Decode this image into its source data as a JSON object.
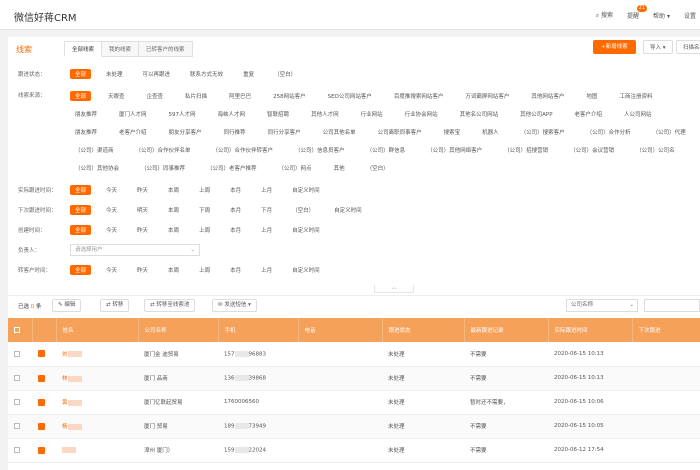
{
  "app": {
    "title": "微信好蒋CRM"
  },
  "topnav": {
    "search": "搜索",
    "reminder": "提醒",
    "reminder_badge": "21",
    "help": "帮助",
    "settings": "设置"
  },
  "leads": {
    "title": "线索",
    "tabs": [
      "全部线索",
      "我的线索",
      "已转客户的线索"
    ],
    "new_button": "+新增线索",
    "import_button": "导入 ▾",
    "scan_button": "扫描名"
  },
  "filters": {
    "follow_status": {
      "label": "跟进状态：",
      "options": [
        "全部",
        "未处理",
        "可以再跟进",
        "联系方式无效",
        "重复",
        "（空白）"
      ]
    },
    "source": {
      "label": "线索来源：",
      "rows": [
        [
          "全部",
          "天眼查",
          "企查查",
          "私片扫描",
          "阿里巴巴",
          "258网站客户",
          "SEO公司网站客户",
          "百度推搜索网站客户",
          "万词霸屏网站客户",
          "其他网站客户",
          "地图",
          "工商注册资料"
        ],
        [
          "朋友推荐",
          "厦门人才网",
          "597人才网",
          "海峡人才网",
          "智联招聘",
          "其他人才网",
          "行业网站",
          "行业协会网站",
          "其他名公司网站",
          "其他公司APP",
          "老客户介绍",
          "人公司网站"
        ],
        [
          "朋友推荐",
          "老客户介绍",
          "朋友分享客户",
          "同行推荐",
          "同行分享客户",
          "公司其他名单",
          "公司离职同事客户",
          "搜索宝",
          "机器人",
          "（公司）搜索客户",
          "（公司）合作分析",
          "（公司）代理"
        ],
        [
          "（公司）渠道商",
          "（公司）合作伙伴名单",
          "（公司）合作伙伴转客户",
          "（公司）信息员客户",
          "（公司）群信息",
          "（公司）其他网络客户",
          "（公司）招搜营销",
          "（公司）会议营销",
          "（公司）公司名"
        ],
        [
          "（公司）其他协会",
          "（公司）同事推荐",
          "（公司）老客户推荐",
          "（公司）网点",
          "其他",
          "（空白）"
        ]
      ]
    },
    "last_follow_time": {
      "label": "实际跟进时间：",
      "options": [
        "全部",
        "今天",
        "昨天",
        "本周",
        "上周",
        "本月",
        "上月",
        "自定义时间"
      ]
    },
    "next_follow_time": {
      "label": "下次跟进时间：",
      "options": [
        "全部",
        "今天",
        "明天",
        "本周",
        "下周",
        "本月",
        "下月",
        "（空白）",
        "自定义时间"
      ]
    },
    "created_time": {
      "label": "创建时间：",
      "options": [
        "全部",
        "今天",
        "昨天",
        "本周",
        "上周",
        "本月",
        "上月",
        "自定义时间"
      ]
    },
    "owner": {
      "label": "负责人：",
      "placeholder": "请选择用户"
    },
    "converted_time": {
      "label": "转客户时间：",
      "options": [
        "全部",
        "今天",
        "昨天",
        "本周",
        "上周",
        "本月",
        "上月",
        "自定义时间"
      ]
    }
  },
  "toolbar": {
    "selected_prefix": "已选",
    "selected_count": "0",
    "selected_suffix": "条",
    "edit": "编辑",
    "transfer": "转移",
    "convert": "转移至线索池",
    "sms": "发送短信 ▾",
    "scope": "公司名称"
  },
  "table": {
    "headers": [
      "",
      "",
      "姓名",
      "公司名称",
      "手机",
      "电话",
      "跟进状态",
      "最新跟进记录",
      "实际跟进时间",
      "下次跟进"
    ],
    "rows": [
      {
        "name": "刘",
        "company": "厦门金 迪贸易",
        "mobile_pre": "157",
        "mobile_post": "96883",
        "status": "未处理",
        "record": "不需要",
        "time": "2020-06-15 10:13"
      },
      {
        "name": "林",
        "company": "厦门 品商",
        "mobile_pre": "136",
        "mobile_post": "39868",
        "status": "未处理",
        "record": "不需要",
        "time": "2020-06-15 10:13"
      },
      {
        "name": "黄",
        "company": "厦门亿联起贸易",
        "mobile_pre": "17600",
        "mobile_post": "06560",
        "status": "未处理",
        "record": "暂时还不需要，",
        "time": "2020-06-15 10:06"
      },
      {
        "name": "杨",
        "company": "厦门 贸易",
        "mobile_pre": "189",
        "mobile_post": "73949",
        "status": "未处理",
        "record": "不需要",
        "time": "2020-06-15 10:05"
      },
      {
        "name": "",
        "company": "漳州 厦门）",
        "mobile_pre": "159",
        "mobile_post": "22024",
        "status": "未处理",
        "record": "不需要",
        "time": "2020-06-12 17:54"
      }
    ]
  }
}
